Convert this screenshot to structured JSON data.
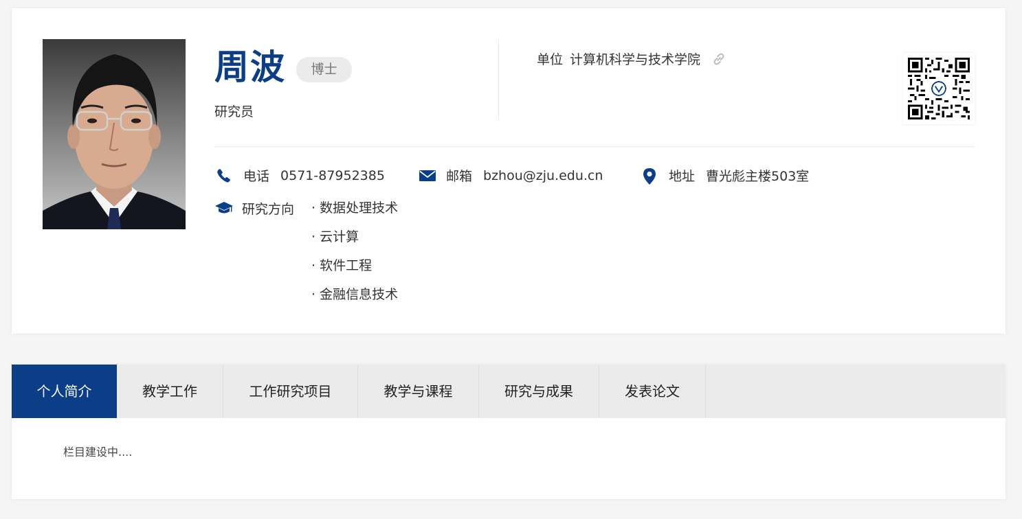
{
  "profile": {
    "name": "周波",
    "degree": "博士",
    "title": "研究员",
    "unit_label": "单位",
    "unit_value": "计算机科学与技术学院",
    "contacts": {
      "phone_label": "电话",
      "phone_value": "0571-87952385",
      "email_label": "邮箱",
      "email_value": "bzhou@zju.edu.cn",
      "address_label": "地址",
      "address_value": "曹光彪主楼503室"
    },
    "research": {
      "label": "研究方向",
      "items": [
        "数据处理技术",
        "云计算",
        "软件工程",
        "金融信息技术"
      ]
    }
  },
  "tabs": [
    {
      "label": "个人简介",
      "active": true
    },
    {
      "label": "教学工作",
      "active": false
    },
    {
      "label": "工作研究项目",
      "active": false
    },
    {
      "label": "教学与课程",
      "active": false
    },
    {
      "label": "研究与成果",
      "active": false
    },
    {
      "label": "发表论文",
      "active": false
    }
  ],
  "content": {
    "text": "栏目建设中...."
  },
  "colors": {
    "accent": "#0b3e86",
    "background": "#f5f5f5",
    "tab_bar": "#ebebeb"
  },
  "icons": [
    "phone-icon",
    "envelope-icon",
    "location-pin-icon",
    "graduation-cap-icon",
    "link-icon",
    "qr-code"
  ]
}
